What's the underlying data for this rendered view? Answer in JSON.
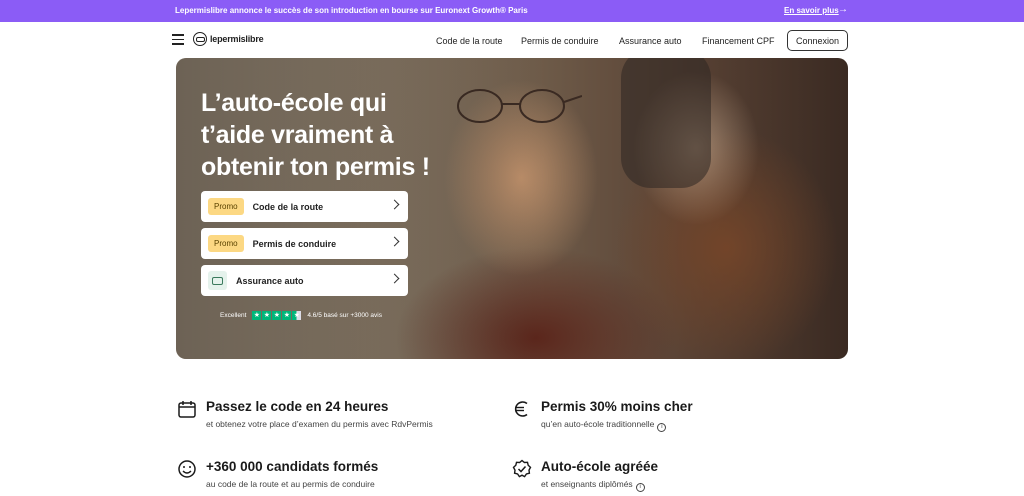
{
  "announcement": {
    "message": "Lepermislibre annonce le succès de son introduction en bourse sur Euronext Growth® Paris",
    "link": "En savoir plus",
    "arrow": "→"
  },
  "nav": {
    "logo_text": "lepermislibre",
    "links": [
      "Code de la route",
      "Permis de conduire",
      "Assurance auto",
      "Financement CPF"
    ],
    "login": "Connexion"
  },
  "hero": {
    "title_lines": [
      "L’auto-école qui",
      "t’aide vraiment à",
      "obtenir ton permis !"
    ],
    "cards": [
      {
        "badge": "Promo",
        "label": "Code de la route"
      },
      {
        "badge": "Promo",
        "label": "Permis de conduire"
      },
      {
        "icon": "car-icon",
        "label": "Assurance auto"
      }
    ],
    "rating": {
      "label": "Excellent",
      "stars": 4.5,
      "text": "4.6/5 basé sur +3000 avis"
    }
  },
  "features": [
    {
      "icon": "calendar-icon",
      "title": "Passez le code en 24 heures",
      "subtitle": "et obtenez votre place d’examen du permis avec RdvPermis",
      "info": false
    },
    {
      "icon": "euro-icon",
      "title": "Permis 30% moins cher",
      "subtitle": "qu’en auto-école traditionnelle",
      "info": true
    },
    {
      "icon": "smiley-icon",
      "title": "+360 000 candidats formés",
      "subtitle": "au code de la route et au permis de conduire",
      "info": false
    },
    {
      "icon": "badge-check-icon",
      "title": "Auto-école agréée",
      "subtitle": "et enseignants diplômés",
      "info": true
    }
  ],
  "colors": {
    "announcement_bg": "#8b5cf6",
    "promo_badge": "#fcd883",
    "trustpilot": "#00b67a"
  }
}
